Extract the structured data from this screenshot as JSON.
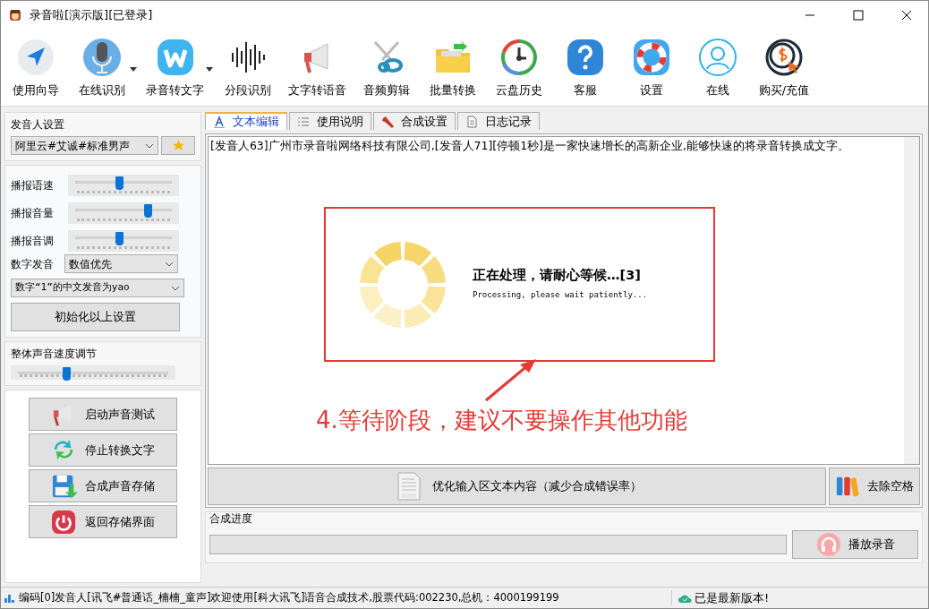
{
  "window": {
    "title": "录音啦[演示版][已登录]"
  },
  "toolbar": [
    {
      "label": "使用向导",
      "dropdown": false
    },
    {
      "label": "在线识别",
      "dropdown": true
    },
    {
      "label": "录音转文字",
      "dropdown": true
    },
    {
      "label": "分段识别",
      "dropdown": false
    },
    {
      "label": "文字转语音",
      "dropdown": false
    },
    {
      "label": "音频剪辑",
      "dropdown": false
    },
    {
      "label": "批量转换",
      "dropdown": false
    },
    {
      "label": "云盘历史",
      "dropdown": false
    },
    {
      "label": "客服",
      "dropdown": false
    },
    {
      "label": "设置",
      "dropdown": false
    },
    {
      "label": "在线",
      "dropdown": false
    },
    {
      "label": "购买/充值",
      "dropdown": false
    }
  ],
  "speaker_settings": {
    "title": "发音人设置",
    "voice": "阿里云#艾诚#标准男声"
  },
  "sliders": [
    {
      "label": "播报语速",
      "level": 0.45
    },
    {
      "label": "播报音量",
      "level": 0.75
    },
    {
      "label": "播报音调",
      "level": 0.45
    }
  ],
  "digit_reading": {
    "label": "数字发音",
    "value": "数值优先",
    "one_reading": "数字“1”的中文发音为yao"
  },
  "reset_button": "初始化以上设置",
  "overall_speed": {
    "title": "整体声音速度调节",
    "level": 0.32
  },
  "action_buttons": [
    "启动声音测试",
    "停止转换文字",
    "合成声音存储",
    "返回存储界面"
  ],
  "tabs": [
    {
      "label": "文本编辑",
      "selected": true
    },
    {
      "label": "使用说明",
      "selected": false
    },
    {
      "label": "合成设置",
      "selected": false
    },
    {
      "label": "日志记录",
      "selected": false
    }
  ],
  "editor_text": "[发音人63]广州市录音啦网络科技有限公司,[发音人71][停顿1秒]是一家快速增长的高新企业,能够快速的将录音转换成文字。",
  "processing": {
    "title": "正在处理，请耐心等候…[3]",
    "subtitle": "Processing, please wait patiently..."
  },
  "annotation": "4.等待阶段，建议不要操作其他功能",
  "optimize_button": "优化输入区文本内容（减少合成错误率）",
  "remove_spaces_button": "去除空格",
  "progress": {
    "title": "合成进度",
    "level": 0
  },
  "play_button": "播放录音",
  "status_bar": {
    "message": "编码[0]发音人[讯飞#普通话_楠楠_童声]欢迎使用[科大讯飞]语音合成技术,股票代码:002230,总机：4000199199",
    "version": "已是最新版本!"
  }
}
